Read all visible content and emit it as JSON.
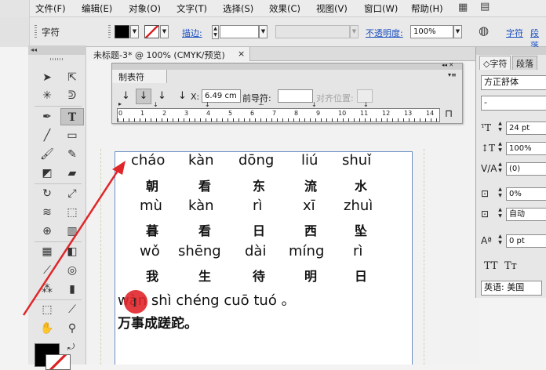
{
  "menu": [
    "文件(F)",
    "编辑(E)",
    "对象(O)",
    "文字(T)",
    "选择(S)",
    "效果(C)",
    "视图(V)",
    "窗口(W)",
    "帮助(H)"
  ],
  "control": {
    "tool_label": "字符",
    "stroke_label": "描边:",
    "opacity_label": "不透明度:",
    "opacity_value": "100%",
    "char_link": "字符",
    "para_link": "段落"
  },
  "document": {
    "tab_title": "未标题-3* @ 100% (CMYK/预览)",
    "close": "×"
  },
  "tabs_panel": {
    "title": "制表符",
    "x_label": "X:",
    "x_value": "6.49 cm",
    "leader_label": "前导符:",
    "leader_value": "",
    "align_label": "对齐位置:",
    "ruler_ticks": [
      "0",
      "1",
      "2",
      "3",
      "4",
      "5",
      "6",
      "7",
      "8",
      "9",
      "10",
      "11",
      "12",
      "13",
      "14"
    ]
  },
  "char_panel": {
    "tab_char": "字符",
    "tab_para": "段落",
    "font_family": "方正舒体",
    "font_style": "-",
    "font_size": "24 pt",
    "vscale": "100%",
    "kerning": "(0)",
    "tracking": "0%",
    "auto": "自动",
    "baseline": "0 pt",
    "tt1": "TT",
    "tt2": "Tт",
    "language": "英语: 美国"
  },
  "artboard_text": {
    "rows": [
      {
        "pinyin": [
          "cháo",
          "kàn",
          "dōng",
          "liú",
          "shuǐ"
        ],
        "hanzi": [
          "朝",
          "看",
          "东",
          "流",
          "水"
        ]
      },
      {
        "pinyin": [
          "mù",
          "kàn",
          "rì",
          "xī",
          "zhuì"
        ],
        "hanzi": [
          "暮",
          "看",
          "日",
          "西",
          "坠"
        ]
      },
      {
        "pinyin": [
          "wǒ",
          "shēng",
          "dài",
          "míng",
          "rì"
        ],
        "hanzi": [
          "我",
          "生",
          "待",
          "明",
          "日"
        ]
      }
    ],
    "line4_pinyin": "wàn shì chéng cuō tuó 。",
    "line4_hanzi": "万事成蹉跎。"
  },
  "colors": {
    "accent_link": "#1a4fc0",
    "annotation_red": "#e0262a"
  }
}
